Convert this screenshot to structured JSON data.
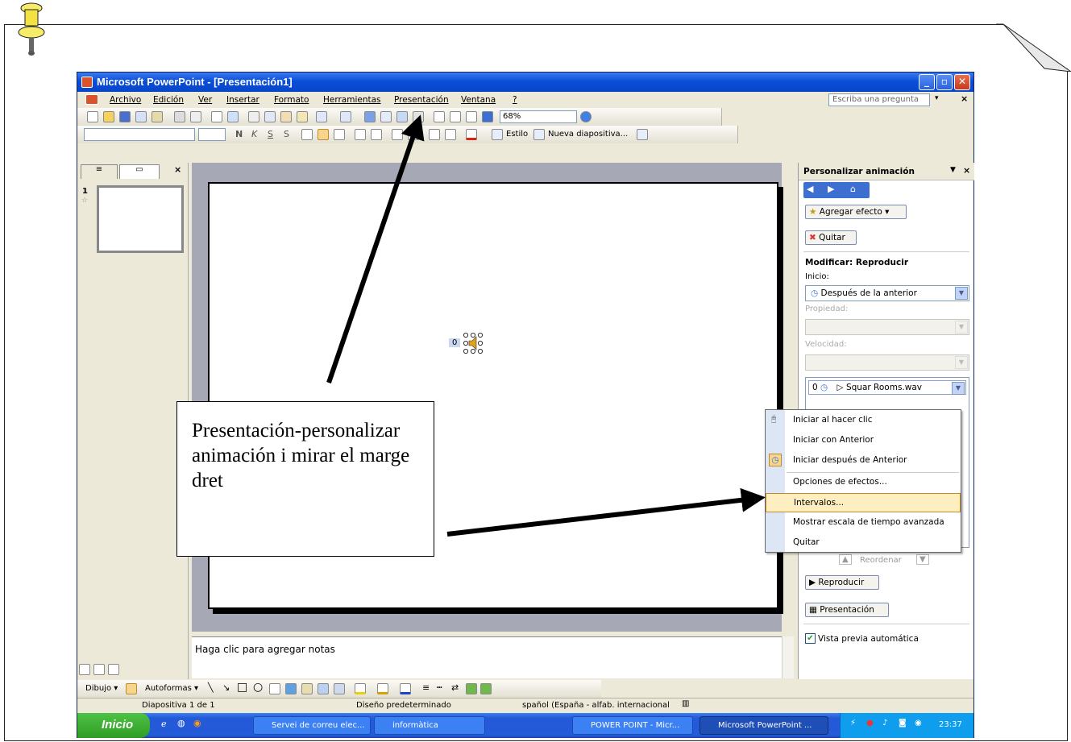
{
  "window": {
    "title": "Microsoft PowerPoint - [Presentación1]",
    "min": "_",
    "max": "▫",
    "close": "✕"
  },
  "menu": {
    "items": [
      "Archivo",
      "Edición",
      "Ver",
      "Insertar",
      "Formato",
      "Herramientas",
      "Presentación",
      "Ventana",
      "?"
    ],
    "ask_placeholder": "Escriba una pregunta",
    "zoom": "68%"
  },
  "format_toolbar": {
    "style_label": "Estilo",
    "new_slide_label": "Nueva diapositiva..."
  },
  "slides_panel": {
    "slide_number": "1",
    "close": "×"
  },
  "slide": {
    "sound_anim_badge": "0"
  },
  "notes": {
    "placeholder": "Haga clic para agregar notas"
  },
  "task_pane": {
    "title": "Personalizar animación",
    "add_effect": "Agregar efecto ▾",
    "remove": "Quitar",
    "modify_heading": "Modificar: Reproducir",
    "start_label": "Inicio:",
    "start_value": "Después de la anterior",
    "property_label": "Propiedad:",
    "speed_label": "Velocidad:",
    "list_item_index": "0",
    "list_item_name": "Squar Rooms.wav",
    "reorder_label": "Reordenar",
    "play_button": "Reproducir",
    "slideshow_button": "Presentación",
    "autopreview_label": "Vista previa automática",
    "autopreview_checked": true
  },
  "context_menu": {
    "items": [
      {
        "label": "Iniciar al hacer clic",
        "icon": "mouse-icon"
      },
      {
        "label": "Iniciar con Anterior"
      },
      {
        "label": "Iniciar después de Anterior",
        "icon": "clock-icon"
      },
      {
        "label": "Opciones de efectos..."
      },
      {
        "label": "Intervalos...",
        "highlighted": true
      },
      {
        "label": "Mostrar escala de tiempo avanzada"
      },
      {
        "label": "Quitar"
      }
    ]
  },
  "draw_toolbar": {
    "draw_label": "Dibujo ▾",
    "autoshapes_label": "Autoformas ▾"
  },
  "status_bar": {
    "slide": "Diapositiva 1 de 1",
    "design": "Diseño predeterminado",
    "language": "spañol (España - alfab. internacional"
  },
  "taskbar": {
    "start": "Inicio",
    "tasks": [
      "Servei de correu elec...",
      "informàtica",
      "POWER POINT - Micr...",
      "Microsoft PowerPoint ..."
    ],
    "time": "23:37"
  },
  "callout": {
    "text": "Presentación-personalizar animación i mirar el marge dret"
  },
  "colors": {
    "title_bar": "#0a4ed8",
    "taskbar": "#245bd9",
    "start_button": "#2f9c24",
    "menu_highlight": "#ffeebf"
  }
}
